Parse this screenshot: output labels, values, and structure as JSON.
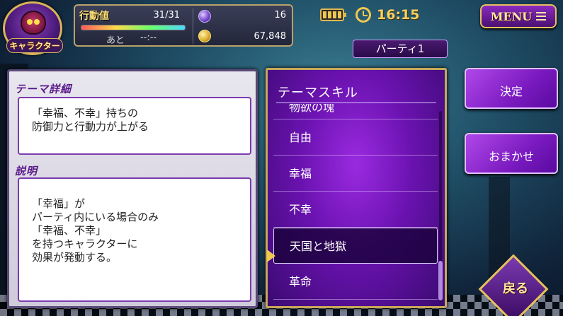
{
  "character": {
    "label": "キャラクター"
  },
  "status": {
    "stamina_label": "行動値",
    "stamina_value": "31/31",
    "stamina_fraction": 1.0,
    "remain_label": "あと",
    "remain_value": "--:--",
    "gems": "16",
    "coins": "67,848"
  },
  "topbar": {
    "time": "16:15",
    "menu_label": "MENU"
  },
  "party": {
    "label": "パーティ1"
  },
  "info": {
    "theme_header": "テーマ詳細",
    "theme_lines": [
      "「幸福、不幸」持ちの",
      "防御力と行動力が上がる"
    ],
    "desc_header": "説明",
    "desc_lines": [
      "「幸福」が",
      "パーティ内にいる場合のみ",
      "「幸福、不幸」",
      "を持つキャラクターに",
      "効果が発動する。"
    ]
  },
  "skills": {
    "header": "テーマスキル",
    "items": [
      "物欲の塊",
      "自由",
      "幸福",
      "不幸",
      "天国と地獄",
      "革命"
    ],
    "selected_index": 4
  },
  "buttons": {
    "decide": "決定",
    "auto": "おまかせ",
    "back": "戻る"
  },
  "colors": {
    "accent_gold": "#e8c060",
    "panel_purple": "#6a12b0",
    "header_purple": "#5a1a8a"
  }
}
